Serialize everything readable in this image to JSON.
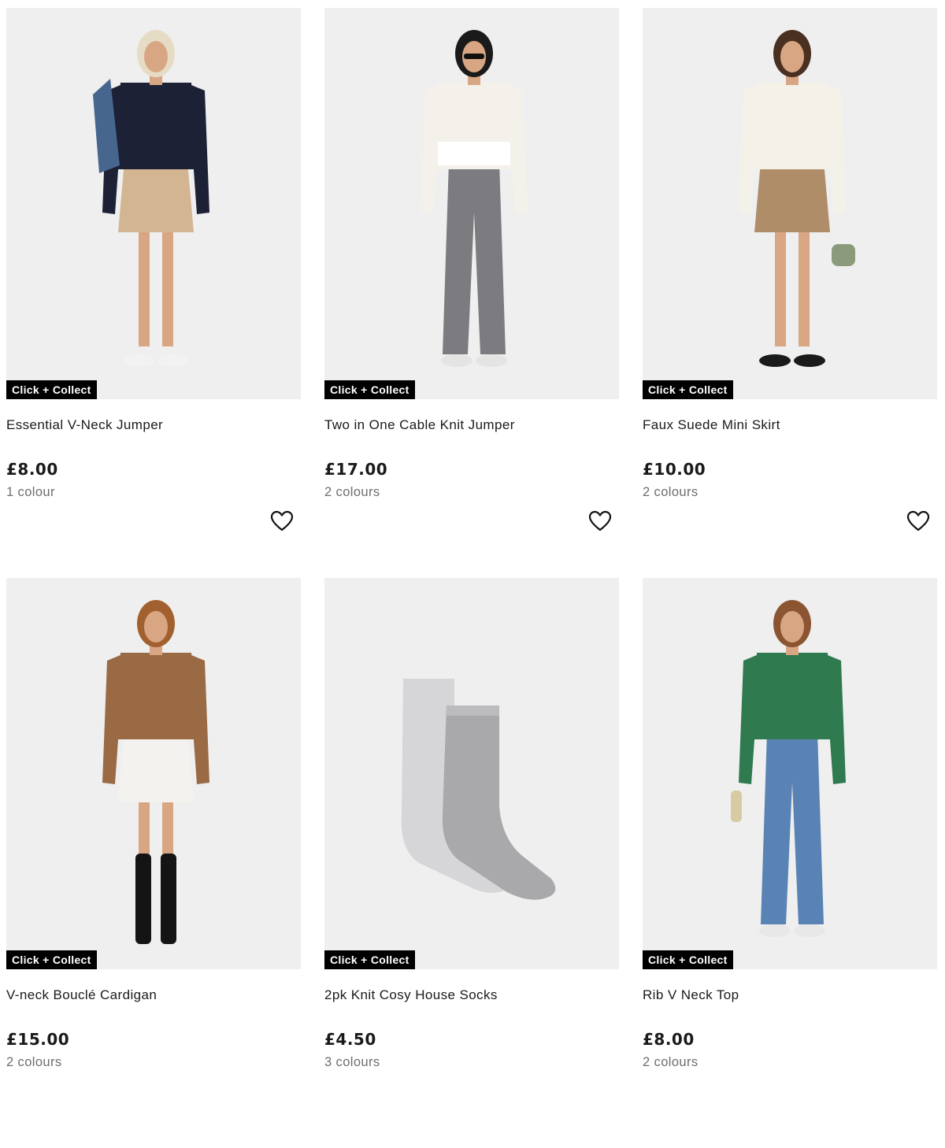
{
  "products": [
    {
      "name": "Essential V-Neck Jumper",
      "price": "£8.00",
      "colours": "1 colour",
      "badge": "Click + Collect",
      "image_icon": "woman-v-neck-jumper-photo",
      "colors": {
        "top": "#1c2136",
        "bottom": "#d3b592",
        "extra": "#47668e",
        "hair": "#e6dcc5",
        "shoes": "#f2f2f2"
      }
    },
    {
      "name": "Two in One Cable Knit Jumper",
      "price": "£17.00",
      "colours": "2 colours",
      "badge": "Click + Collect",
      "image_icon": "woman-cable-knit-jumper-photo",
      "colors": {
        "top": "#f3f1ea",
        "bottom": "#7c7c80",
        "extra": "#ffffff",
        "hair": "#1a1a1a",
        "shoes": "#e4e4e4"
      }
    },
    {
      "name": "Faux Suede Mini Skirt",
      "price": "£10.00",
      "colours": "2 colours",
      "badge": "Click + Collect",
      "image_icon": "woman-suede-mini-skirt-photo",
      "colors": {
        "top": "#f4f1e8",
        "bottom": "#b08d69",
        "extra": "#8c9a7c",
        "hair": "#4a3020",
        "shoes": "#1a1a1a"
      }
    },
    {
      "name": "V-neck Bouclé Cardigan",
      "price": "£15.00",
      "colours": "2 colours",
      "badge": "Click + Collect",
      "image_icon": "woman-boucle-cardigan-photo",
      "colors": {
        "top": "#9a6a45",
        "bottom": "#f4f2ee",
        "extra": "#141414",
        "hair": "#a2602f",
        "shoes": "#141414"
      }
    },
    {
      "name": "2pk Knit Cosy House Socks",
      "price": "£4.50",
      "colours": "3 colours",
      "badge": "Click + Collect",
      "image_icon": "grey-socks-photo",
      "colors": {
        "top": "#d6d6d8",
        "bottom": "#a9a8ab",
        "extra": "#bcbcbe",
        "hair": "#000000",
        "shoes": "#000000"
      }
    },
    {
      "name": "Rib V Neck Top",
      "price": "£8.00",
      "colours": "2 colours",
      "badge": "Click + Collect",
      "image_icon": "woman-rib-v-neck-top-photo",
      "colors": {
        "top": "#2f7a4e",
        "bottom": "#5a83b5",
        "extra": "#d8cba4",
        "hair": "#8a5530",
        "shoes": "#e8e8e8"
      }
    }
  ],
  "wishlist_icon": "heart-outline-icon"
}
